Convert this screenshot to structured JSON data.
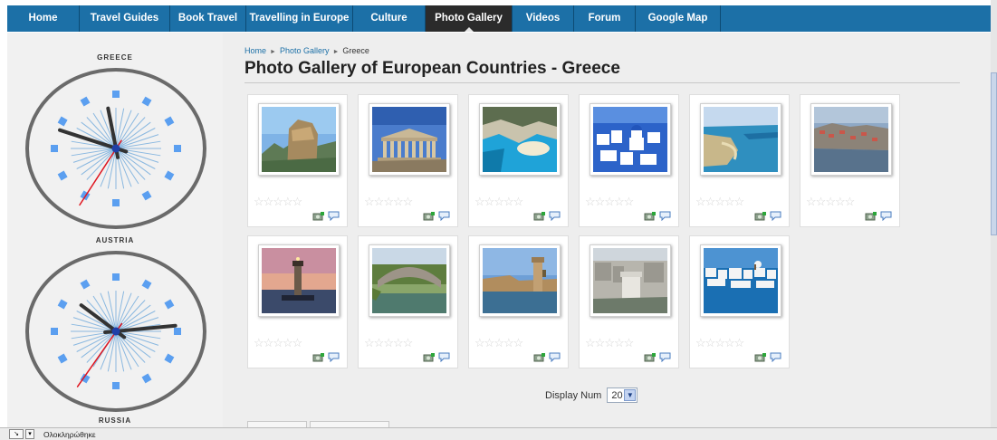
{
  "nav": {
    "items": [
      {
        "label": "Home",
        "active": false
      },
      {
        "label": "Travel Guides",
        "active": false
      },
      {
        "label": "Book Travel",
        "active": false
      },
      {
        "label": "Travelling in Europe",
        "active": false
      },
      {
        "label": "Culture",
        "active": false
      },
      {
        "label": "Photo Gallery",
        "active": true
      },
      {
        "label": "Videos",
        "active": false
      },
      {
        "label": "Forum",
        "active": false
      },
      {
        "label": "Google Map",
        "active": false
      }
    ]
  },
  "sidebar": {
    "clocks": [
      {
        "city": "GREECE"
      },
      {
        "city": "AUSTRIA"
      },
      {
        "city": "RUSSIA"
      }
    ]
  },
  "breadcrumb": {
    "home": "Home",
    "gallery": "Photo Gallery",
    "current": "Greece"
  },
  "page_title": "Photo Gallery of European Countries - Greece",
  "photos": [
    {
      "icon": "meteora-photo"
    },
    {
      "icon": "parthenon-photo"
    },
    {
      "icon": "navagio-beach-photo"
    },
    {
      "icon": "santorini-photo"
    },
    {
      "icon": "coastal-lagoon-photo"
    },
    {
      "icon": "kastoria-photo"
    },
    {
      "icon": "lighthouse-photo"
    },
    {
      "icon": "stone-bridge-photo"
    },
    {
      "icon": "rhodes-harbour-photo"
    },
    {
      "icon": "white-tower-photo"
    },
    {
      "icon": "mykonos-photo"
    }
  ],
  "display_num": {
    "label": "Display Num",
    "value": "20"
  },
  "status": {
    "text": "Ολοκληρώθηκε"
  },
  "colors": {
    "nav_bg": "#1c70a7",
    "nav_active": "#2b2b2b",
    "link": "#1c70a7",
    "clock_tick": "#5b9ff0",
    "clock_ray": "#8ab8e0",
    "second_hand": "#e0141e"
  }
}
